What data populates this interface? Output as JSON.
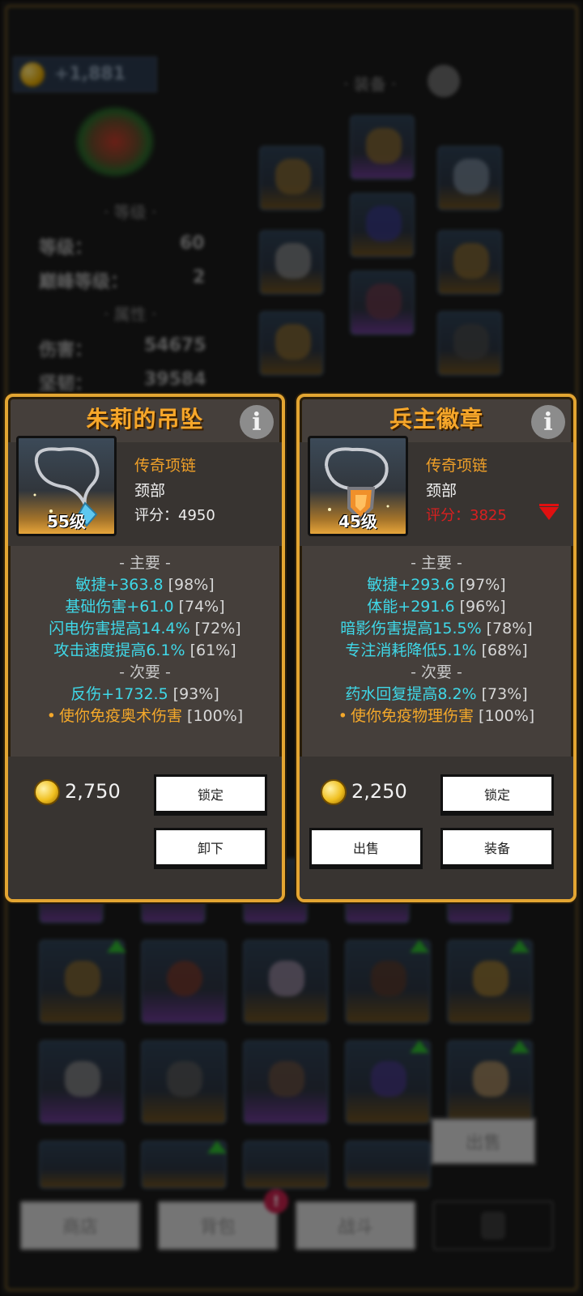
{
  "background": {
    "gold_amount": "+1,881",
    "equipment_header": "· 装备 ·",
    "level_header": "· 等级 ·",
    "attr_header": "· 属性 ·",
    "rows": [
      {
        "label": "等级：",
        "value": "60"
      },
      {
        "label": "巅峰等级：",
        "value": "2"
      },
      {
        "label": "伤害：",
        "value": "54675"
      },
      {
        "label": "坚韧：",
        "value": "39584"
      }
    ],
    "sell_button": "出售",
    "nav": {
      "shop": "商店",
      "bag": "背包",
      "battle": "战斗",
      "bag_badge": "!"
    }
  },
  "left": {
    "title": "朱莉的吊坠",
    "info_icon": "i",
    "level": "55级",
    "type": "传奇项链",
    "slot": "颈部",
    "score": "评分：4950",
    "primary_header": "- 主要 -",
    "primary": [
      {
        "text": "敏捷+363.8",
        "pct": "[98%]"
      },
      {
        "text": "基础伤害+61.0",
        "pct": "[74%]"
      },
      {
        "text": "闪电伤害提高14.4%",
        "pct": "[72%]"
      },
      {
        "text": "攻击速度提高6.1%",
        "pct": "[61%]"
      }
    ],
    "secondary_header": "- 次要 -",
    "secondary": [
      {
        "text": "反伤+1732.5",
        "pct": "[93%]"
      }
    ],
    "legendary": {
      "text": "使你免疫奥术伤害",
      "pct": "[100%]"
    },
    "price": "2,750",
    "lock_button": "锁定",
    "unequip_button": "卸下"
  },
  "right": {
    "title": "兵主徽章",
    "info_icon": "i",
    "level": "45级",
    "type": "传奇项链",
    "slot": "颈部",
    "score": "评分：3825",
    "primary_header": "- 主要 -",
    "primary": [
      {
        "text": "敏捷+293.6",
        "pct": "[97%]"
      },
      {
        "text": "体能+291.6",
        "pct": "[96%]"
      },
      {
        "text": "暗影伤害提高15.5%",
        "pct": "[78%]"
      },
      {
        "text": "专注消耗降低5.1%",
        "pct": "[68%]"
      }
    ],
    "secondary_header": "- 次要 -",
    "secondary": [
      {
        "text": "药水回复提高8.2%",
        "pct": "[73%]"
      }
    ],
    "legendary": {
      "text": "使你免疫物理伤害",
      "pct": "[100%]"
    },
    "price": "2,250",
    "lock_button": "锁定",
    "sell_button": "出售",
    "equip_button": "装备"
  },
  "colors": {
    "gold_title": "#f7a72a",
    "stat_cyan": "#3fd8e8",
    "legendary_orange": "#f4a82a",
    "worse_red": "#d82020"
  }
}
